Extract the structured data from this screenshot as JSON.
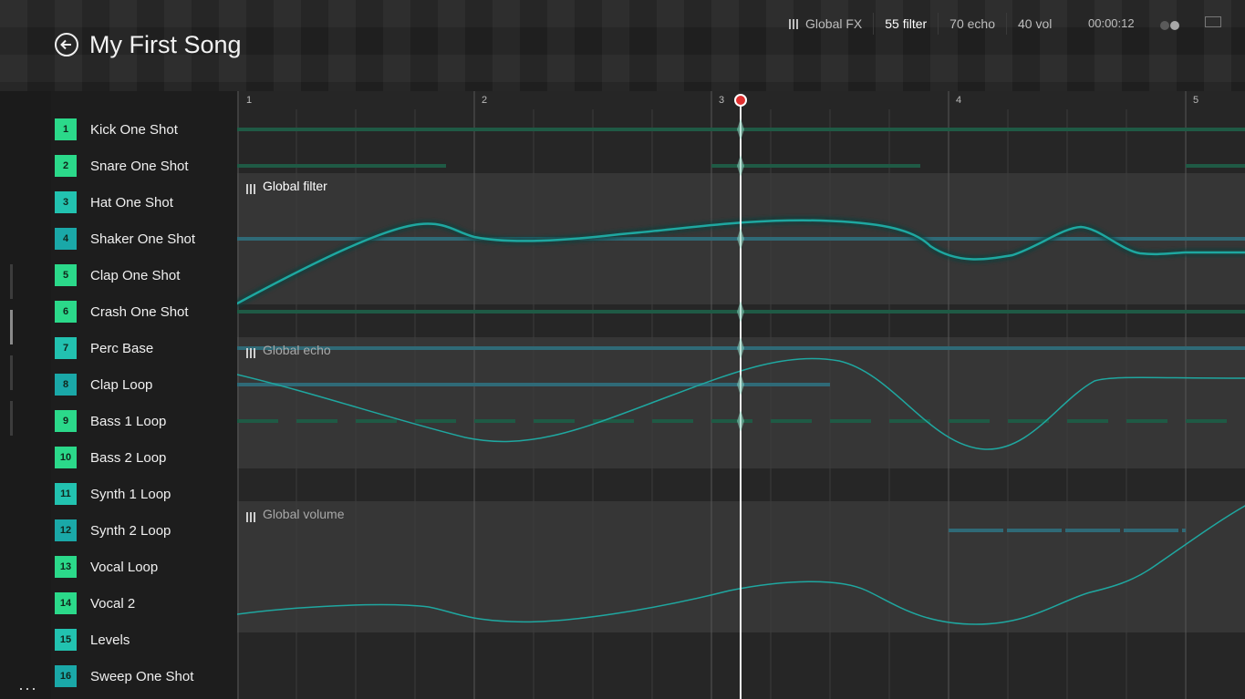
{
  "header": {
    "title": "My First Song",
    "global_fx_label": "Global FX",
    "filter_label": "55 filter",
    "echo_label": "70 echo",
    "vol_label": "40 vol",
    "time": "00:00:12"
  },
  "ruler": [
    "1",
    "2",
    "3",
    "4",
    "5"
  ],
  "tracks": [
    {
      "n": "1",
      "name": "Kick One Shot",
      "color": "#2bd98a"
    },
    {
      "n": "2",
      "name": "Snare One Shot",
      "color": "#2bd98a"
    },
    {
      "n": "3",
      "name": "Hat One Shot",
      "color": "#22c2b0"
    },
    {
      "n": "4",
      "name": "Shaker One Shot",
      "color": "#1aa8a8"
    },
    {
      "n": "5",
      "name": "Clap One Shot",
      "color": "#2bd98a"
    },
    {
      "n": "6",
      "name": "Crash One Shot",
      "color": "#2bd98a"
    },
    {
      "n": "7",
      "name": "Perc Base",
      "color": "#22c2b0"
    },
    {
      "n": "8",
      "name": "Clap Loop",
      "color": "#1aa8a8"
    },
    {
      "n": "9",
      "name": "Bass 1 Loop",
      "color": "#2bd98a"
    },
    {
      "n": "10",
      "name": "Bass 2 Loop",
      "color": "#2bd98a"
    },
    {
      "n": "11",
      "name": "Synth 1 Loop",
      "color": "#22c2b0"
    },
    {
      "n": "12",
      "name": "Synth 2 Loop",
      "color": "#1aa8a8"
    },
    {
      "n": "13",
      "name": "Vocal Loop",
      "color": "#2bd98a"
    },
    {
      "n": "14",
      "name": "Vocal 2",
      "color": "#2bd98a"
    },
    {
      "n": "15",
      "name": "Levels",
      "color": "#22c2b0"
    },
    {
      "n": "16",
      "name": "Sweep One Shot",
      "color": "#1aa8a8"
    }
  ],
  "fx": {
    "filter_title": "Global filter",
    "echo_title": "Global echo",
    "volume_title": "Global volume"
  },
  "colors": {
    "accent": "#1fa7a0",
    "playhead": "#e03030"
  }
}
